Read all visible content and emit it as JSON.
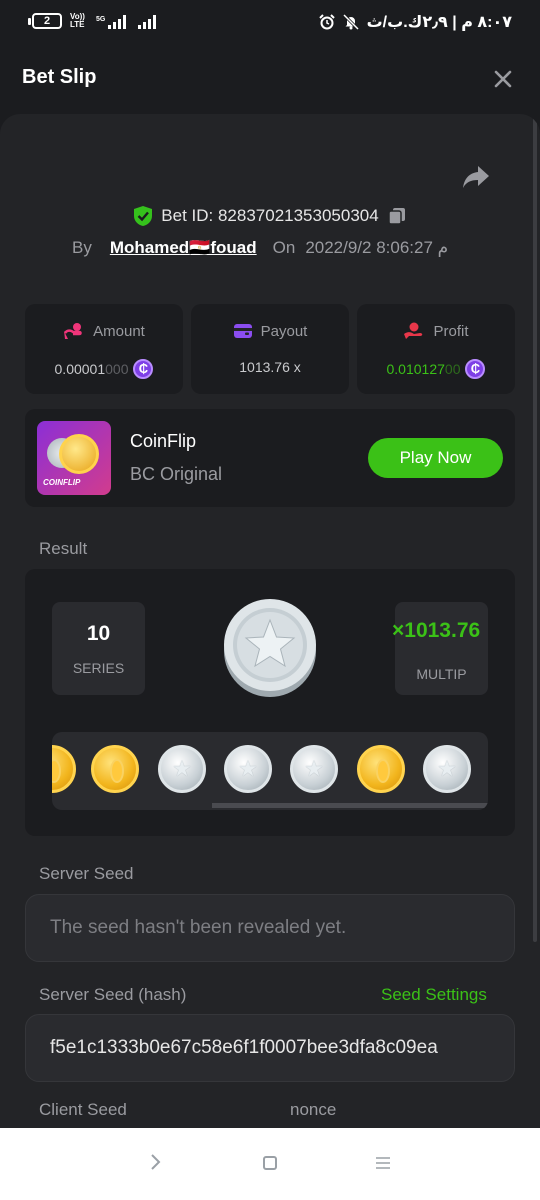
{
  "status_bar": {
    "battery": "2",
    "volte": "Vo)) LTE",
    "net": "5G",
    "time": "٨:٠٧ م | ٢٫٩ك.ب/ث"
  },
  "header": {
    "title": "Bet Slip"
  },
  "bet": {
    "id_label": "Bet ID: 82837021353050304",
    "by_label": "By",
    "user": "Mohamed🇪🇬fouad",
    "on_label": "On",
    "datetime": "2022/9/2 م 8:06:27"
  },
  "stats": {
    "amount": {
      "label": "Amount",
      "value_main": "0.00001",
      "value_dim": "000",
      "coin": "₵"
    },
    "payout": {
      "label": "Payout",
      "value": "1013.76 x"
    },
    "profit": {
      "label": "Profit",
      "value_main": "0.010127",
      "value_dim": "00",
      "coin": "₵"
    }
  },
  "game": {
    "name": "CoinFlip",
    "subtitle": "BC Original",
    "thumb_label": "COINFLIP",
    "play_label": "Play Now"
  },
  "result": {
    "label": "Result",
    "series_value": "10",
    "series_label": "SERIES",
    "multiplier_value": "×1013.76",
    "multiplier_label": "MULTIP",
    "coins": [
      "gold",
      "gold",
      "silver",
      "silver",
      "silver",
      "gold",
      "silver"
    ]
  },
  "server_seed": {
    "label": "Server Seed",
    "value": "The seed hasn't been revealed yet."
  },
  "server_seed_hash": {
    "label": "Server Seed (hash)",
    "settings_label": "Seed Settings",
    "value": "f5e1c1333b0e67c58e6f1f0007bee3dfa8c09ea"
  },
  "client_seed": {
    "label": "Client Seed",
    "nonce_label": "nonce"
  },
  "colors": {
    "accent_green": "#3bc117",
    "coin_purple": "#7e3fe6",
    "amount_icon": "#f0357a",
    "payout_icon": "#8b4df0",
    "profit_icon": "#e8374a",
    "shield_green": "#35c11c"
  }
}
